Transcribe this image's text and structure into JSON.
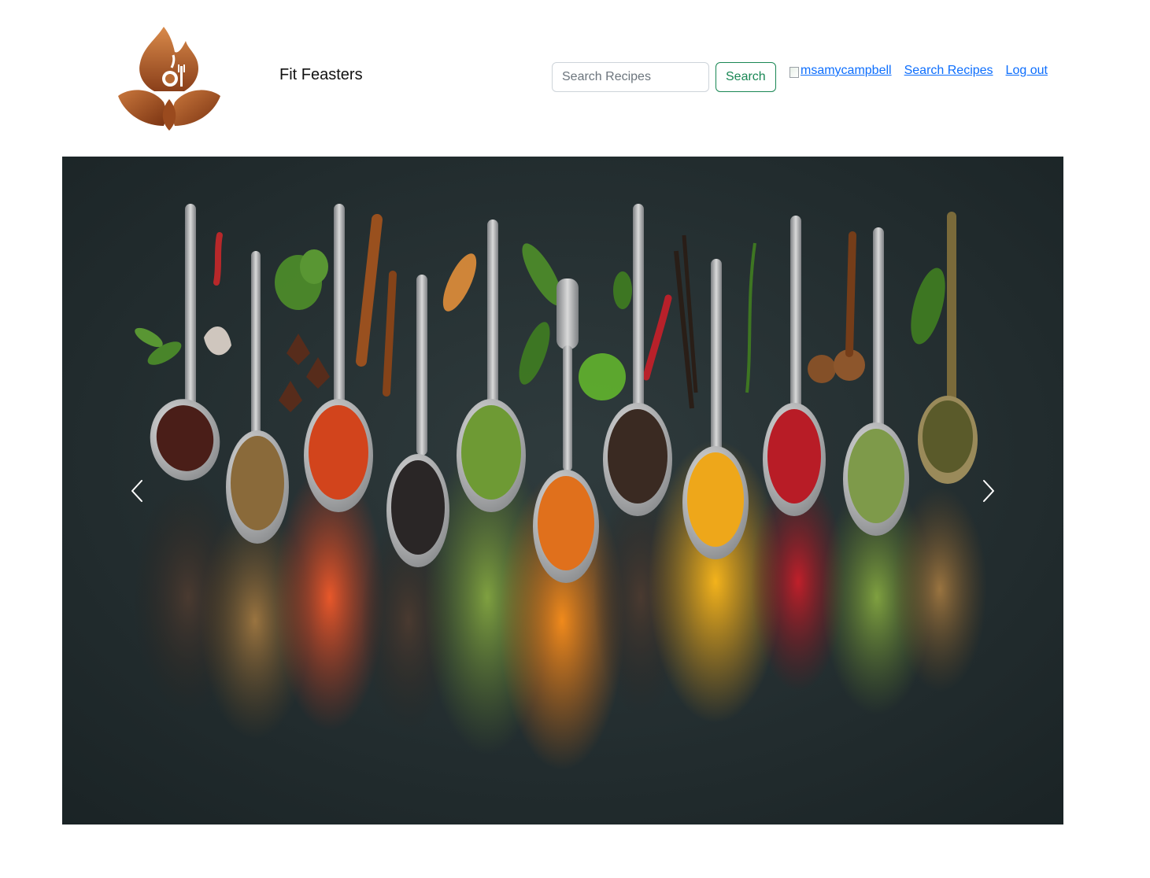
{
  "header": {
    "brand_name": "Fit Feasters",
    "search": {
      "placeholder": "Search Recipes",
      "value": "",
      "button_label": "Search"
    },
    "nav": {
      "avatar_alt": "msamycampbell",
      "search_recipes_label": "Search Recipes",
      "logout_label": "Log out"
    }
  },
  "carousel": {
    "prev_icon": "chevron-left-icon",
    "next_icon": "chevron-right-icon"
  },
  "colors": {
    "link": "#0d6efd",
    "accent": "#198754",
    "logo_brown": "#a8582a"
  }
}
